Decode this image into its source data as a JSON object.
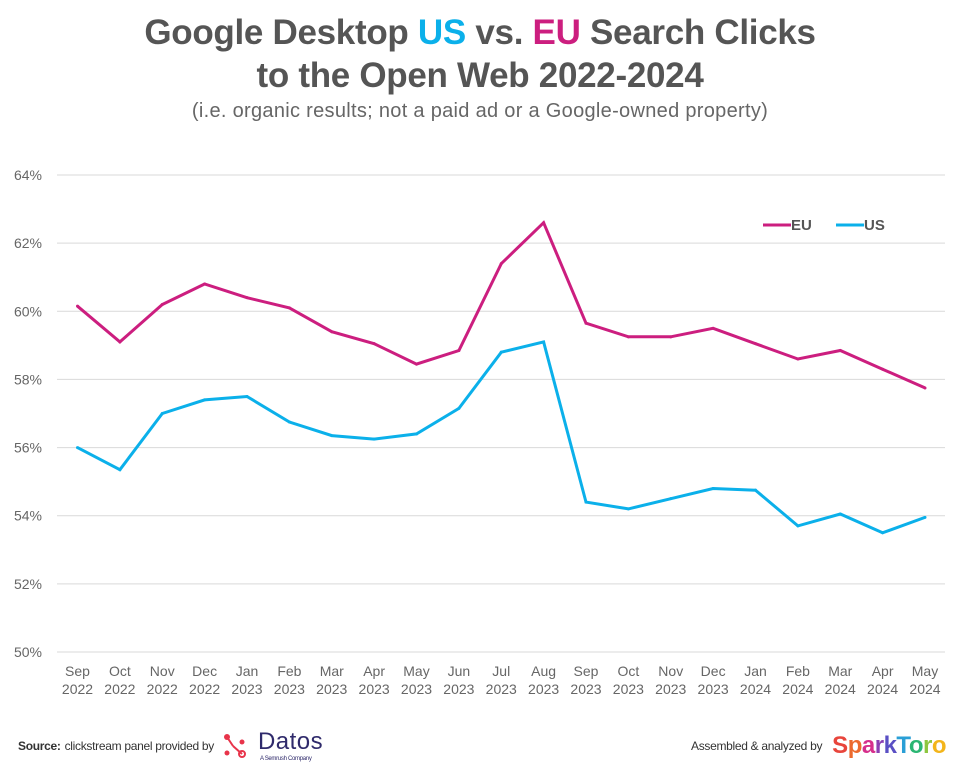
{
  "header": {
    "title_line1_part1": "Google Desktop ",
    "title_line1_us": "US",
    "title_line1_part2": " vs. ",
    "title_line1_eu": "EU",
    "title_line1_part3": " Search Clicks",
    "title_line2": "to the Open Web 2022-2024",
    "subtitle": "(i.e. organic results; not a paid ad or a Google-owned property)"
  },
  "chart_data": {
    "type": "line",
    "title": "Google Desktop US vs. EU Search Clicks to the Open Web 2022-2024",
    "subtitle": "(i.e. organic results; not a paid ad or a Google-owned property)",
    "xlabel": "",
    "ylabel": "",
    "ylim": [
      50,
      64
    ],
    "yticks": [
      50,
      52,
      54,
      56,
      58,
      60,
      62,
      64
    ],
    "ytick_format": "{v}%",
    "grid": true,
    "legend_position": "top-right",
    "categories": [
      [
        "Sep",
        "2022"
      ],
      [
        "Oct",
        "2022"
      ],
      [
        "Nov",
        "2022"
      ],
      [
        "Dec",
        "2022"
      ],
      [
        "Jan",
        "2023"
      ],
      [
        "Feb",
        "2023"
      ],
      [
        "Mar",
        "2023"
      ],
      [
        "Apr",
        "2023"
      ],
      [
        "May",
        "2023"
      ],
      [
        "Jun",
        "2023"
      ],
      [
        "Jul",
        "2023"
      ],
      [
        "Aug",
        "2023"
      ],
      [
        "Sep",
        "2023"
      ],
      [
        "Oct",
        "2023"
      ],
      [
        "Nov",
        "2023"
      ],
      [
        "Dec",
        "2023"
      ],
      [
        "Jan",
        "2024"
      ],
      [
        "Feb",
        "2024"
      ],
      [
        "Mar",
        "2024"
      ],
      [
        "Apr",
        "2024"
      ],
      [
        "May",
        "2024"
      ]
    ],
    "series": [
      {
        "name": "EU",
        "color": "#cc1e7f",
        "values": [
          60.15,
          59.1,
          60.2,
          60.8,
          60.4,
          60.1,
          59.4,
          59.05,
          58.45,
          58.85,
          61.4,
          62.6,
          59.65,
          59.25,
          59.25,
          59.5,
          59.05,
          58.6,
          58.85,
          58.3,
          57.75
        ]
      },
      {
        "name": "US",
        "color": "#0bb0ea",
        "values": [
          56.0,
          55.35,
          57.0,
          57.4,
          57.5,
          56.75,
          56.35,
          56.25,
          56.4,
          57.15,
          58.8,
          59.1,
          54.4,
          54.2,
          54.5,
          54.8,
          54.75,
          53.7,
          54.05,
          53.5,
          53.95
        ]
      }
    ]
  },
  "footer": {
    "source_label": "Source:",
    "source_text": "clickstream panel provided by",
    "datos_name": "Datos",
    "datos_sub": "A Semrush Company",
    "assembled_text": "Assembled & analyzed by",
    "sparktoro_letters": [
      "S",
      "p",
      "a",
      "r",
      "k",
      "T",
      "o",
      "r",
      "o"
    ]
  },
  "colors": {
    "us": "#0bb0ea",
    "eu": "#cc1e7f",
    "title": "#555555",
    "grid": "#d9d9d9",
    "datos_red": "#e8344a",
    "datos_navy": "#2f2a6b"
  }
}
